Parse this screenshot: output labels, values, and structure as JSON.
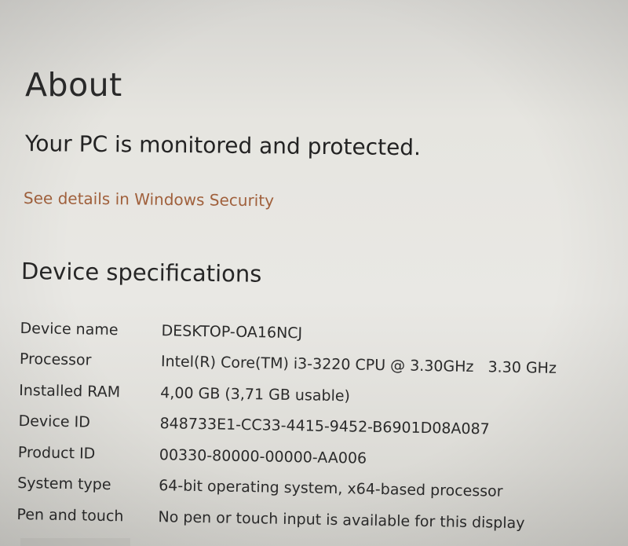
{
  "page": {
    "title": "About"
  },
  "security": {
    "status": "Your PC is monitored and protected.",
    "link_label": "See details in Windows Security"
  },
  "device_specs": {
    "title": "Device specifications",
    "rows": [
      {
        "label": "Device name",
        "value": "DESKTOP-OA16NCJ"
      },
      {
        "label": "Processor",
        "value": "Intel(R) Core(TM) i3-3220 CPU @ 3.30GHz   3.30 GHz"
      },
      {
        "label": "Installed RAM",
        "value": "4,00 GB (3,71 GB usable)"
      },
      {
        "label": "Device ID",
        "value": "848733E1-CC33-4415-9452-B6901D08A087"
      },
      {
        "label": "Product ID",
        "value": "00330-80000-00000-AA006"
      },
      {
        "label": "System type",
        "value": "64-bit operating system, x64-based processor"
      },
      {
        "label": "Pen and touch",
        "value": "No pen or touch input is available for this display"
      }
    ]
  },
  "colors": {
    "link": "#a0603c",
    "text": "#232323",
    "background": "#e6e5e0"
  }
}
